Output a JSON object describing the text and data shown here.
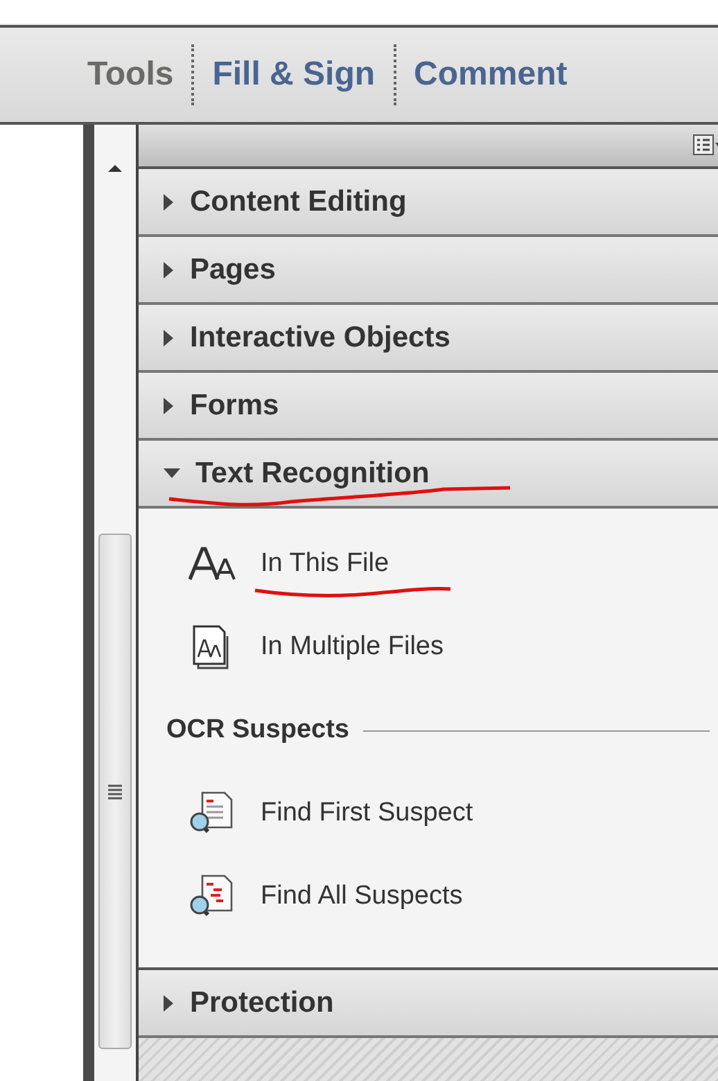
{
  "tabs": [
    {
      "label": "Tools",
      "selected": true
    },
    {
      "label": "Fill & Sign",
      "selected": false
    },
    {
      "label": "Comment",
      "selected": false
    }
  ],
  "sections": [
    {
      "title": "Content Editing",
      "expanded": false,
      "underlined": false
    },
    {
      "title": "Pages",
      "expanded": false,
      "underlined": false
    },
    {
      "title": "Interactive Objects",
      "expanded": false,
      "underlined": false
    },
    {
      "title": "Forms",
      "expanded": false,
      "underlined": false
    },
    {
      "title": "Text Recognition",
      "expanded": true,
      "underlined": true,
      "items": [
        {
          "kind": "action",
          "label": "In This File",
          "underlined": true
        },
        {
          "kind": "action",
          "label": "In Multiple Files",
          "underlined": false
        },
        {
          "kind": "heading",
          "label": "OCR Suspects"
        },
        {
          "kind": "action",
          "label": "Find First Suspect",
          "underlined": false
        },
        {
          "kind": "action",
          "label": "Find All Suspects",
          "underlined": false
        }
      ]
    },
    {
      "title": "Protection",
      "expanded": false,
      "underlined": false
    }
  ]
}
